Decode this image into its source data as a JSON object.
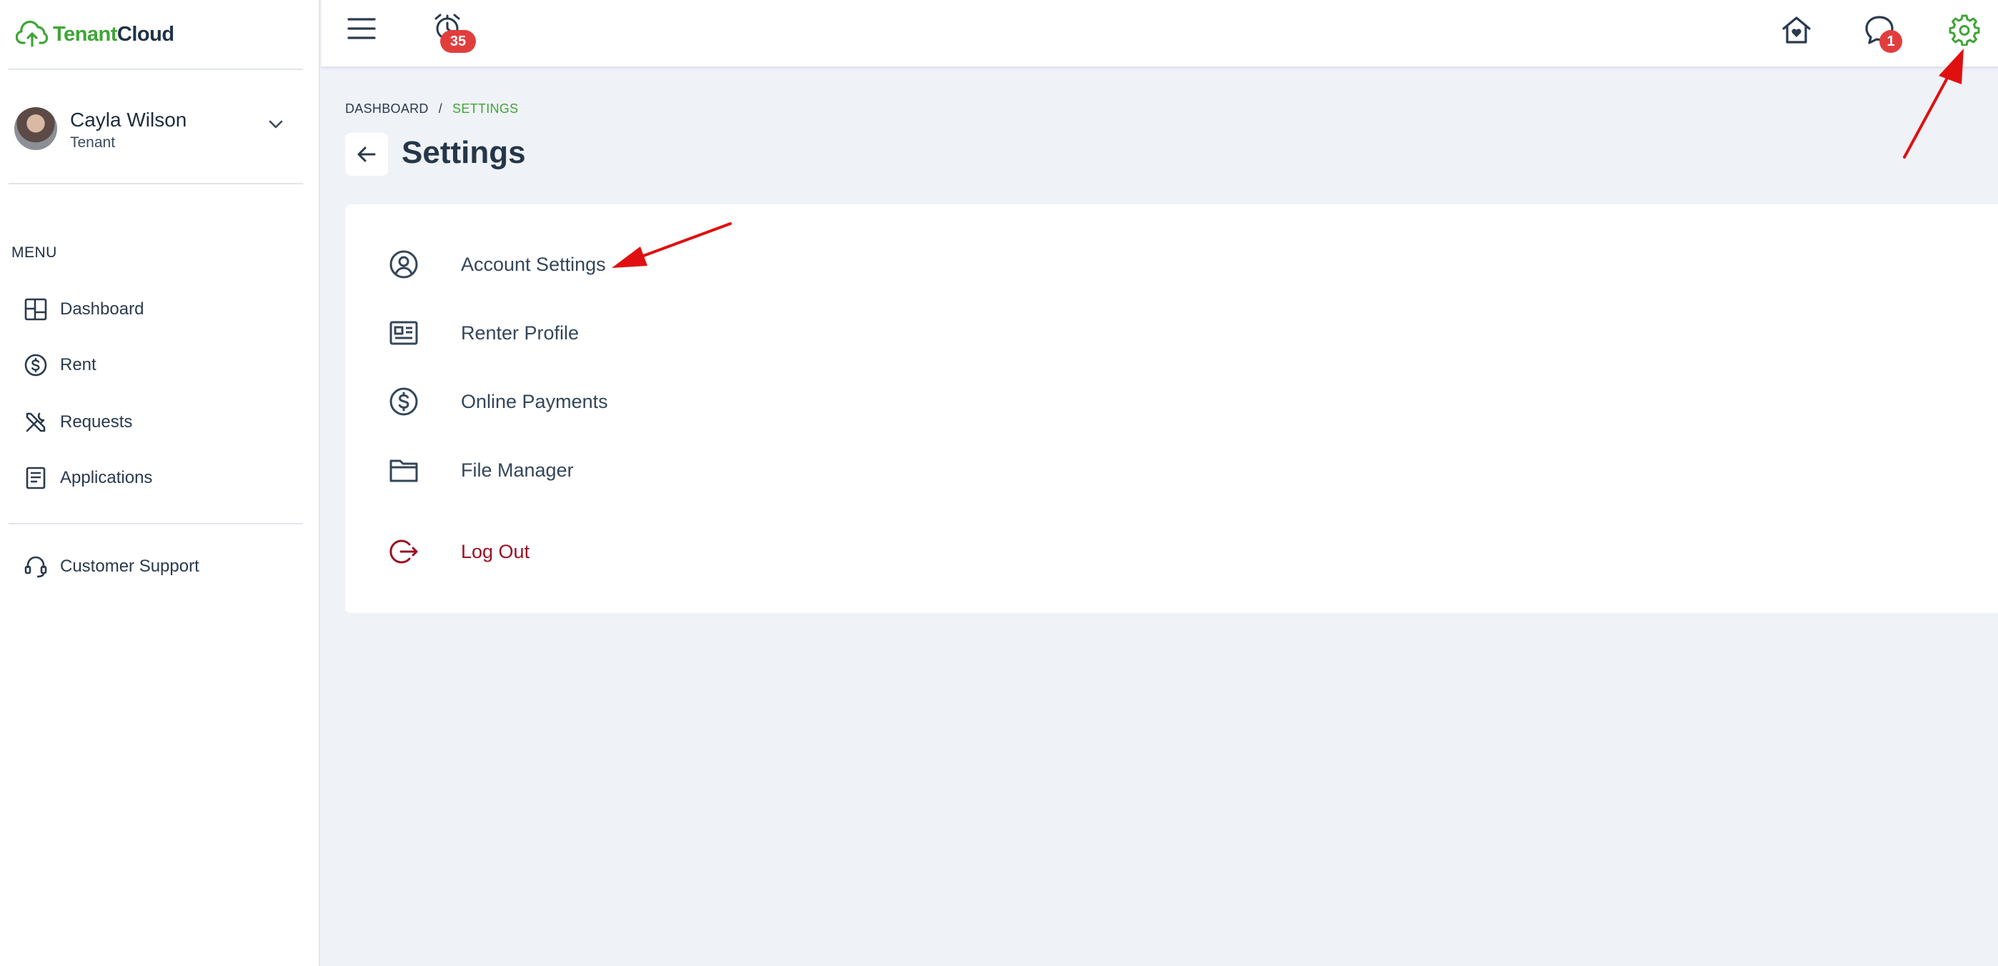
{
  "brand": {
    "part1": "Tenant",
    "part2": "Cloud"
  },
  "user": {
    "name": "Cayla Wilson",
    "role": "Tenant"
  },
  "sidebar": {
    "menu_label": "MENU",
    "items": [
      {
        "label": "Dashboard",
        "icon": "dashboard-grid-icon"
      },
      {
        "label": "Rent",
        "icon": "dollar-circle-icon"
      },
      {
        "label": "Requests",
        "icon": "tools-icon"
      },
      {
        "label": "Applications",
        "icon": "document-icon"
      }
    ],
    "support_label": "Customer Support"
  },
  "topbar": {
    "alarm_badge": "35",
    "messages_badge": "1"
  },
  "breadcrumb": {
    "root": "DASHBOARD",
    "separator": "/",
    "current": "SETTINGS"
  },
  "page": {
    "title": "Settings"
  },
  "settings": {
    "items": [
      {
        "label": "Account Settings",
        "icon": "user-circle-icon"
      },
      {
        "label": "Renter Profile",
        "icon": "id-card-icon"
      },
      {
        "label": "Online Payments",
        "icon": "dollar-circle-icon"
      },
      {
        "label": "File Manager",
        "icon": "folder-icon"
      }
    ],
    "logout_label": "Log Out"
  },
  "colors": {
    "brand_green": "#3fa535",
    "logout_red": "#9b1023",
    "badge_red": "#e23d3d",
    "annotation_red": "#e01010",
    "page_background": "#eff2f7"
  }
}
